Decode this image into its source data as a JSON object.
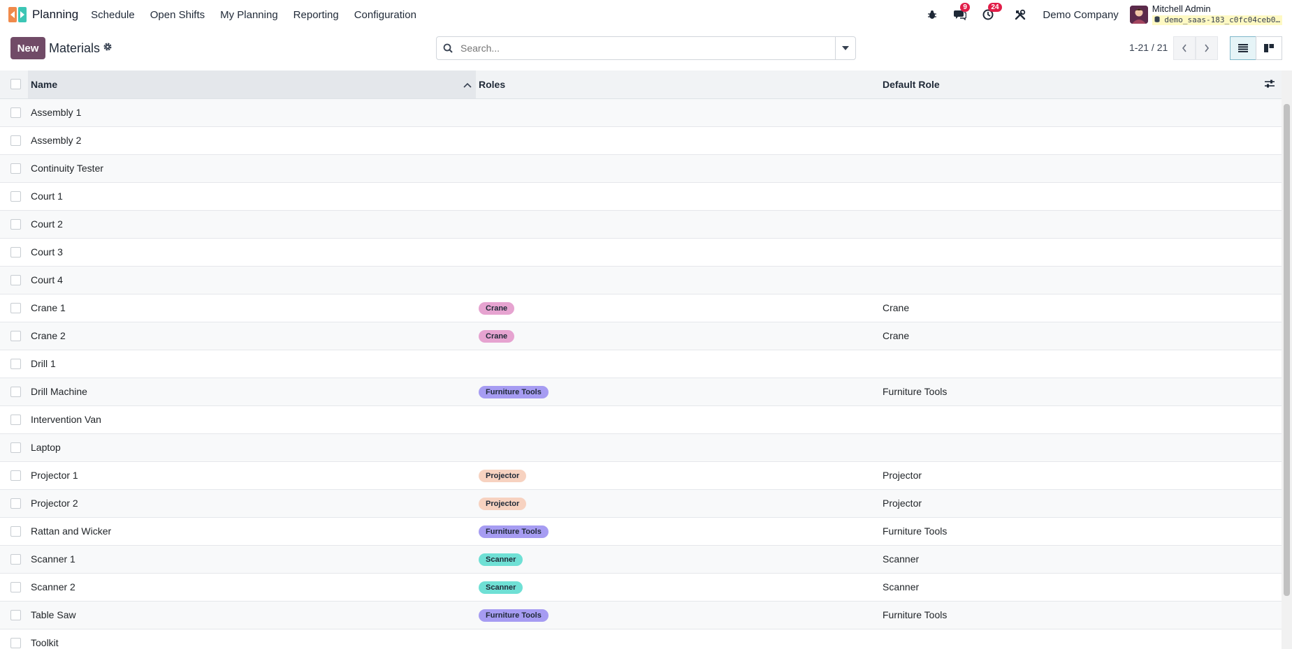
{
  "navbar": {
    "app_name": "Planning",
    "menu": [
      "Schedule",
      "Open Shifts",
      "My Planning",
      "Reporting",
      "Configuration"
    ],
    "messages_badge": "9",
    "activities_badge": "24",
    "company": "Demo Company",
    "user_name": "Mitchell Admin",
    "db_name": "demo_saas-183_c0fc04ceb0…"
  },
  "control": {
    "new_label": "New",
    "title": "Materials",
    "search_placeholder": "Search...",
    "pager": "1-21 / 21"
  },
  "table": {
    "headers": {
      "name": "Name",
      "roles": "Roles",
      "default_role": "Default Role"
    },
    "rows": [
      {
        "name": "Assembly 1",
        "role": "",
        "default_role": ""
      },
      {
        "name": "Assembly 2",
        "role": "",
        "default_role": ""
      },
      {
        "name": "Continuity Tester",
        "role": "",
        "default_role": ""
      },
      {
        "name": "Court 1",
        "role": "",
        "default_role": ""
      },
      {
        "name": "Court 2",
        "role": "",
        "default_role": ""
      },
      {
        "name": "Court 3",
        "role": "",
        "default_role": ""
      },
      {
        "name": "Court 4",
        "role": "",
        "default_role": ""
      },
      {
        "name": "Crane 1",
        "role": "Crane",
        "default_role": "Crane"
      },
      {
        "name": "Crane 2",
        "role": "Crane",
        "default_role": "Crane"
      },
      {
        "name": "Drill 1",
        "role": "",
        "default_role": ""
      },
      {
        "name": "Drill Machine",
        "role": "Furniture Tools",
        "default_role": "Furniture Tools"
      },
      {
        "name": "Intervention Van",
        "role": "",
        "default_role": ""
      },
      {
        "name": "Laptop",
        "role": "",
        "default_role": ""
      },
      {
        "name": "Projector 1",
        "role": "Projector",
        "default_role": "Projector"
      },
      {
        "name": "Projector 2",
        "role": "Projector",
        "default_role": "Projector"
      },
      {
        "name": "Rattan and Wicker",
        "role": "Furniture Tools",
        "default_role": "Furniture Tools"
      },
      {
        "name": "Scanner 1",
        "role": "Scanner",
        "default_role": "Scanner"
      },
      {
        "name": "Scanner 2",
        "role": "Scanner",
        "default_role": "Scanner"
      },
      {
        "name": "Table Saw",
        "role": "Furniture Tools",
        "default_role": "Furniture Tools"
      },
      {
        "name": "Toolkit",
        "role": "",
        "default_role": ""
      }
    ]
  },
  "role_colors": {
    "Crane": "#e6a3d0",
    "Furniture Tools": "#a69cf2",
    "Projector": "#f7d2c0",
    "Scanner": "#6fe0d5"
  },
  "colors": {
    "brand": "#714b67",
    "badge": "#e11d48"
  },
  "icons": {
    "bug": "bug-icon",
    "chat": "chat-icon",
    "activity": "clock-icon",
    "tools": "tools-icon",
    "gear": "gear-icon",
    "search": "search-icon",
    "dropdown": "caret-down-icon",
    "prev": "chevron-left-icon",
    "next": "chevron-right-icon",
    "list_view": "list-view-icon",
    "kanban_view": "kanban-view-icon",
    "sort": "chevron-up-icon",
    "optional_columns": "sliders-icon"
  }
}
